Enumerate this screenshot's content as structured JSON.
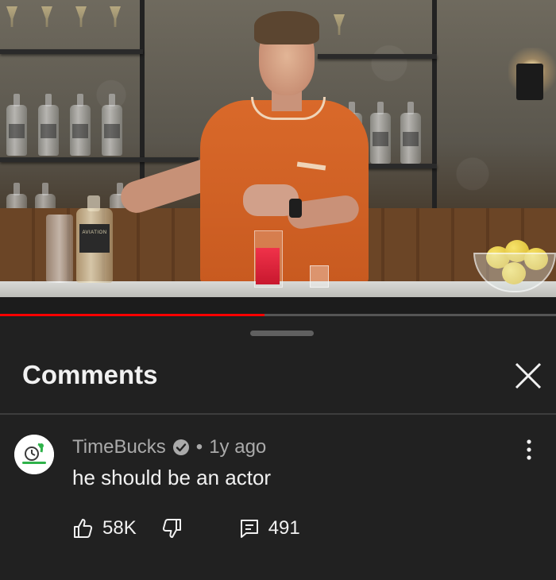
{
  "video": {
    "bottle_label": "AVIATION",
    "progress_percent": 47.5,
    "colors": {
      "progress": "#ff0000",
      "track": "#4a4a4a"
    }
  },
  "panel": {
    "title": "Comments",
    "close_icon": "close-icon",
    "drag_icon": "drag-handle"
  },
  "comment": {
    "author": "TimeBucks",
    "verified_icon": "verified-check-icon",
    "separator": "•",
    "age": "1y ago",
    "text": "he should be an actor",
    "likes": "58K",
    "replies": "491",
    "more_icon": "more-vert-icon",
    "like_icon": "thumbs-up-icon",
    "dislike_icon": "thumbs-down-icon",
    "reply_icon": "reply-icon"
  },
  "colors": {
    "background": "#212121",
    "text_primary": "#f1f1f1",
    "text_secondary": "#aaaaaa",
    "divider": "#3d3d3d"
  }
}
